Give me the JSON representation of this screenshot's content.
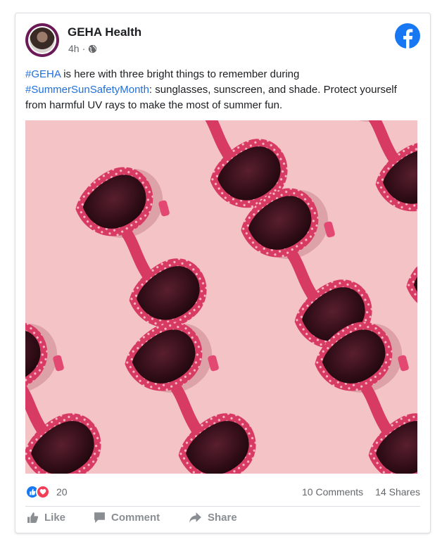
{
  "post": {
    "page_name": "GEHA Health",
    "time": "4h",
    "separator": "·",
    "caption": {
      "hashtag1": "#GEHA",
      "text1": " is here with three bright things to remember during ",
      "hashtag2": "#SummerSunSafetyMonth",
      "text2": ": sunglasses, sunscreen, and shade. Protect yourself from harmful UV rays to make the most of summer fun."
    }
  },
  "icons": {
    "avatar": "geha-avatar",
    "privacy": "globe-icon",
    "brand": "facebook-logo-icon"
  },
  "stats": {
    "reaction_count": "20",
    "comments": "10 Comments",
    "shares": "14 Shares"
  },
  "actions": {
    "like": "Like",
    "comment": "Comment",
    "share": "Share"
  },
  "colors": {
    "link": "#216fdb",
    "facebook_blue": "#1877f2",
    "love_red": "#f33e58",
    "photo_background": "#f4c3c6",
    "sunglass_frame": "#d73a63"
  }
}
